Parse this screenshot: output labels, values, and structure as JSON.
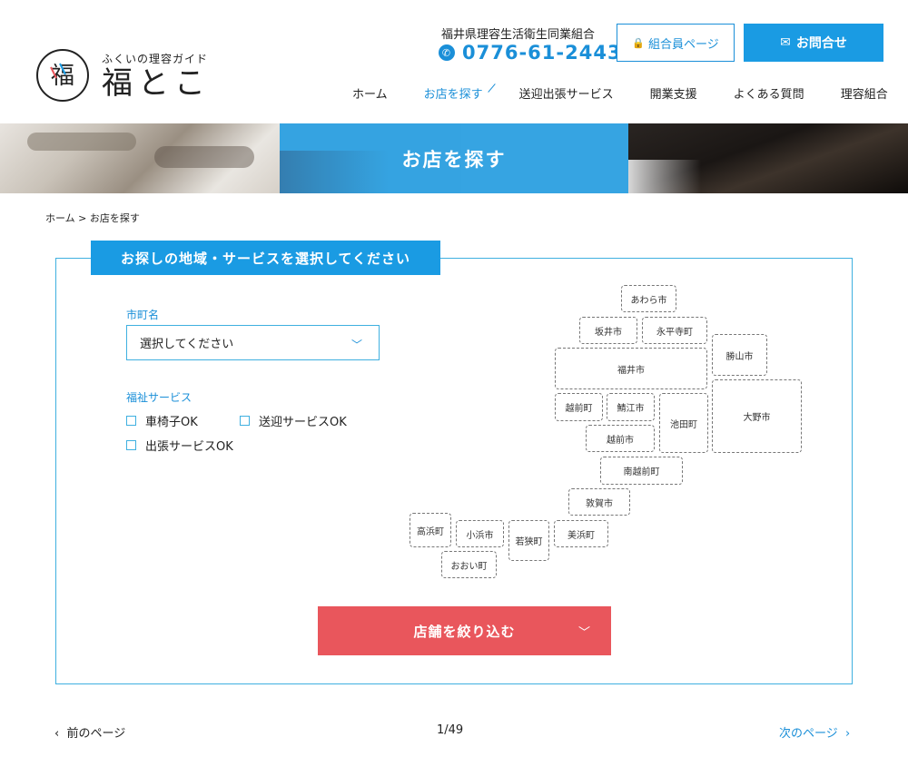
{
  "header": {
    "logo_sub": "ふくいの理容ガイド",
    "logo_main": "福とこ",
    "union_name": "福井県理容生活衛生同業組合",
    "phone": "0776-61-2443",
    "member_page": "組合員ページ",
    "contact": "お問合せ"
  },
  "nav": [
    {
      "label": "ホーム"
    },
    {
      "label": "お店を探す"
    },
    {
      "label": "送迎出張サービス"
    },
    {
      "label": "開業支援"
    },
    {
      "label": "よくある質問"
    },
    {
      "label": "理容組合"
    }
  ],
  "hero": {
    "title": "お店を探す"
  },
  "breadcrumb": "ホーム > お店を探す",
  "search": {
    "heading": "お探しの地域・サービスを選択してください",
    "city_label": "市町名",
    "city_select": "選択してください",
    "welfare_label": "福祉サービス",
    "options": [
      "車椅子OK",
      "送迎サービスOK",
      "出張サービスOK"
    ],
    "filter_button": "店舗を絞り込む"
  },
  "map": {
    "areas": [
      "あわら市",
      "坂井市",
      "永平寺町",
      "勝山市",
      "福井市",
      "越前町",
      "鯖江市",
      "池田町",
      "大野市",
      "越前市",
      "南越前町",
      "敦賀市",
      "高浜町",
      "小浜市",
      "若狭町",
      "美浜町",
      "おおい町"
    ]
  },
  "pager": {
    "prev": "前のページ",
    "page": "1/49",
    "next": "次のページ"
  },
  "colors": {
    "accent": "#1a9be3",
    "button_red": "#e9565c",
    "border": "#3fb0e0"
  }
}
